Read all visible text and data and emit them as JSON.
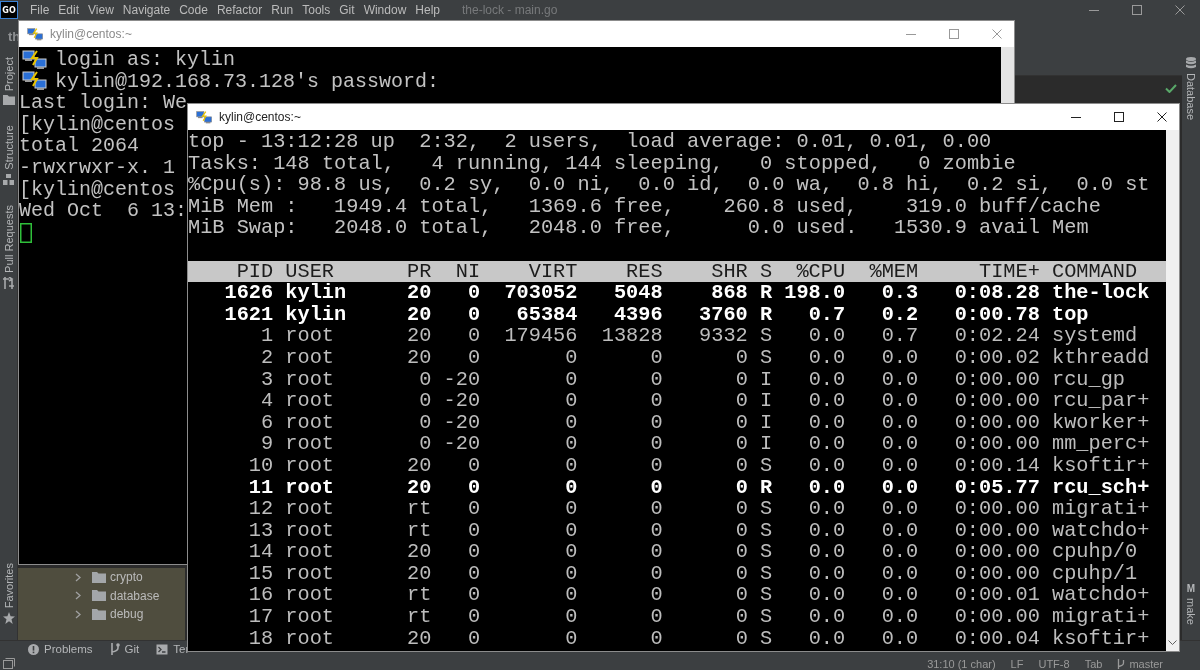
{
  "ide": {
    "logo": "GO",
    "menu": [
      "File",
      "Edit",
      "View",
      "Navigate",
      "Code",
      "Refactor",
      "Run",
      "Tools",
      "Git",
      "Window",
      "Help"
    ],
    "title": "the-lock - main.go",
    "navigation_bar": "th",
    "left_toolbar": {
      "top": [
        "Project",
        "Structure",
        "Pull Requests"
      ],
      "bottom": [
        "Favorites"
      ]
    },
    "right_toolbar": {
      "top": [
        {
          "label": "Database"
        }
      ],
      "bottom": [
        {
          "label": "make",
          "icon_text": "M"
        }
      ]
    },
    "project_tree": [
      {
        "label": "crypto",
        "expanded": false
      },
      {
        "label": "database",
        "expanded": false
      },
      {
        "label": "debug",
        "expanded": false
      }
    ],
    "tool_tabs": [
      "Problems",
      "Git",
      "Ter"
    ],
    "status_bar": {
      "position": "31:10 (1 char)",
      "line_separator": "LF",
      "encoding": "UTF-8",
      "indent": "Tab",
      "branch": "master"
    }
  },
  "terminals": [
    {
      "title": "kylin@centos:~",
      "active": false,
      "lines": [
        {
          "kind": "server",
          "text": "login as: kylin"
        },
        {
          "kind": "server",
          "text": "kylin@192.168.73.128's password:"
        },
        {
          "kind": "output",
          "text": "Last login: We"
        },
        {
          "kind": "output",
          "text": "[kylin@centos"
        },
        {
          "kind": "output",
          "text": "total 2064"
        },
        {
          "kind": "output",
          "text": "-rwxrwxr-x. 1"
        },
        {
          "kind": "output",
          "text": "[kylin@centos"
        },
        {
          "kind": "output",
          "text": "Wed Oct  6 13:"
        }
      ]
    },
    {
      "title": "kylin@centos:~",
      "active": true,
      "summary": [
        "top - 13:12:28 up  2:32,  2 users,  load average: 0.01, 0.01, 0.00",
        "Tasks: 148 total,   4 running, 144 sleeping,   0 stopped,   0 zombie",
        "%Cpu(s): 98.8 us,  0.2 sy,  0.0 ni,  0.0 id,  0.0 wa,  0.8 hi,  0.2 si,  0.0 st",
        "MiB Mem :   1949.4 total,   1369.6 free,    260.8 used,    319.0 buff/cache",
        "MiB Swap:   2048.0 total,   2048.0 free,      0.0 used.   1530.9 avail Mem"
      ],
      "columns": [
        "PID",
        "USER",
        "PR",
        "NI",
        "VIRT",
        "RES",
        "SHR",
        "S",
        "%CPU",
        "%MEM",
        "TIME+",
        "COMMAND"
      ],
      "rows": [
        {
          "cells": [
            "1626",
            "kylin",
            "20",
            "0",
            "703052",
            "5048",
            "868",
            "R",
            "198.0",
            "0.3",
            "0:08.28",
            "the-lock"
          ],
          "highlighted": true
        },
        {
          "cells": [
            "1621",
            "kylin",
            "20",
            "0",
            "65384",
            "4396",
            "3760",
            "R",
            "0.7",
            "0.2",
            "0:00.78",
            "top"
          ],
          "highlighted": true
        },
        {
          "cells": [
            "1",
            "root",
            "20",
            "0",
            "179456",
            "13828",
            "9332",
            "S",
            "0.0",
            "0.7",
            "0:02.24",
            "systemd"
          ],
          "highlighted": false
        },
        {
          "cells": [
            "2",
            "root",
            "20",
            "0",
            "0",
            "0",
            "0",
            "S",
            "0.0",
            "0.0",
            "0:00.02",
            "kthreadd"
          ],
          "highlighted": false
        },
        {
          "cells": [
            "3",
            "root",
            "0",
            "-20",
            "0",
            "0",
            "0",
            "I",
            "0.0",
            "0.0",
            "0:00.00",
            "rcu_gp"
          ],
          "highlighted": false
        },
        {
          "cells": [
            "4",
            "root",
            "0",
            "-20",
            "0",
            "0",
            "0",
            "I",
            "0.0",
            "0.0",
            "0:00.00",
            "rcu_par+"
          ],
          "highlighted": false
        },
        {
          "cells": [
            "6",
            "root",
            "0",
            "-20",
            "0",
            "0",
            "0",
            "I",
            "0.0",
            "0.0",
            "0:00.00",
            "kworker+"
          ],
          "highlighted": false
        },
        {
          "cells": [
            "9",
            "root",
            "0",
            "-20",
            "0",
            "0",
            "0",
            "I",
            "0.0",
            "0.0",
            "0:00.00",
            "mm_perc+"
          ],
          "highlighted": false
        },
        {
          "cells": [
            "10",
            "root",
            "20",
            "0",
            "0",
            "0",
            "0",
            "S",
            "0.0",
            "0.0",
            "0:00.14",
            "ksoftir+"
          ],
          "highlighted": false
        },
        {
          "cells": [
            "11",
            "root",
            "20",
            "0",
            "0",
            "0",
            "0",
            "R",
            "0.0",
            "0.0",
            "0:05.77",
            "rcu_sch+"
          ],
          "highlighted": true
        },
        {
          "cells": [
            "12",
            "root",
            "rt",
            "0",
            "0",
            "0",
            "0",
            "S",
            "0.0",
            "0.0",
            "0:00.00",
            "migrati+"
          ],
          "highlighted": false
        },
        {
          "cells": [
            "13",
            "root",
            "rt",
            "0",
            "0",
            "0",
            "0",
            "S",
            "0.0",
            "0.0",
            "0:00.00",
            "watchdo+"
          ],
          "highlighted": false
        },
        {
          "cells": [
            "14",
            "root",
            "20",
            "0",
            "0",
            "0",
            "0",
            "S",
            "0.0",
            "0.0",
            "0:00.00",
            "cpuhp/0"
          ],
          "highlighted": false
        },
        {
          "cells": [
            "15",
            "root",
            "20",
            "0",
            "0",
            "0",
            "0",
            "S",
            "0.0",
            "0.0",
            "0:00.00",
            "cpuhp/1"
          ],
          "highlighted": false
        },
        {
          "cells": [
            "16",
            "root",
            "rt",
            "0",
            "0",
            "0",
            "0",
            "S",
            "0.0",
            "0.0",
            "0:00.01",
            "watchdo+"
          ],
          "highlighted": false
        },
        {
          "cells": [
            "17",
            "root",
            "rt",
            "0",
            "0",
            "0",
            "0",
            "S",
            "0.0",
            "0.0",
            "0:00.00",
            "migrati+"
          ],
          "highlighted": false
        },
        {
          "cells": [
            "18",
            "root",
            "20",
            "0",
            "0",
            "0",
            "0",
            "S",
            "0.0",
            "0.0",
            "0:00.04",
            "ksoftir+"
          ],
          "highlighted": false
        }
      ]
    }
  ]
}
